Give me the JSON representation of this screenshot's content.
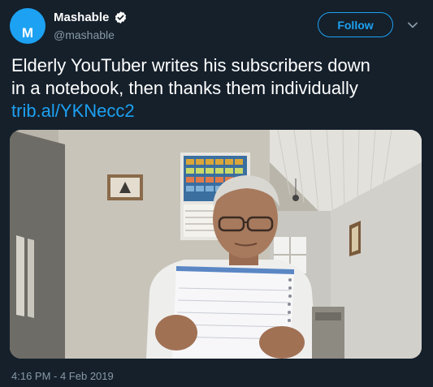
{
  "author": {
    "display_name": "Mashable",
    "handle": "@mashable",
    "avatar_letter": "M",
    "verified": true
  },
  "follow_label": "Follow",
  "tweet": {
    "text_line1": "Elderly YouTuber writes his subscribers down",
    "text_line2": "in a notebook, then thanks them individually",
    "link": "trib.al/YKNecc2"
  },
  "timestamp": "4:16 PM - 4 Feb 2019",
  "colors": {
    "background": "#15202b",
    "accent": "#1da1f2",
    "secondary_text": "#8899a6"
  }
}
